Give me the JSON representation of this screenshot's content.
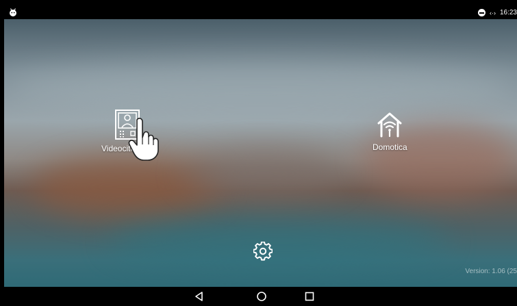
{
  "status_bar": {
    "left_icon": "android-notification-icon",
    "icons": [
      "do-not-disturb-icon",
      "ethernet-icon"
    ],
    "ethernet_glyph": "‹·›",
    "time": "16:23"
  },
  "apps": [
    {
      "label": "Videocitofonia",
      "icon": "intercom-icon"
    },
    {
      "label": "Domotica",
      "icon": "smart-home-icon"
    }
  ],
  "cursor_icon": "hand-pointer-icon",
  "settings_icon": "gear-icon",
  "version_text": "Version: 1.06 (25",
  "nav_bar": {
    "buttons": [
      "back-icon",
      "home-icon",
      "recents-icon"
    ]
  },
  "colors": {
    "status_bar": "#000000",
    "nav_bar": "#000000",
    "text": "#ffffff"
  }
}
